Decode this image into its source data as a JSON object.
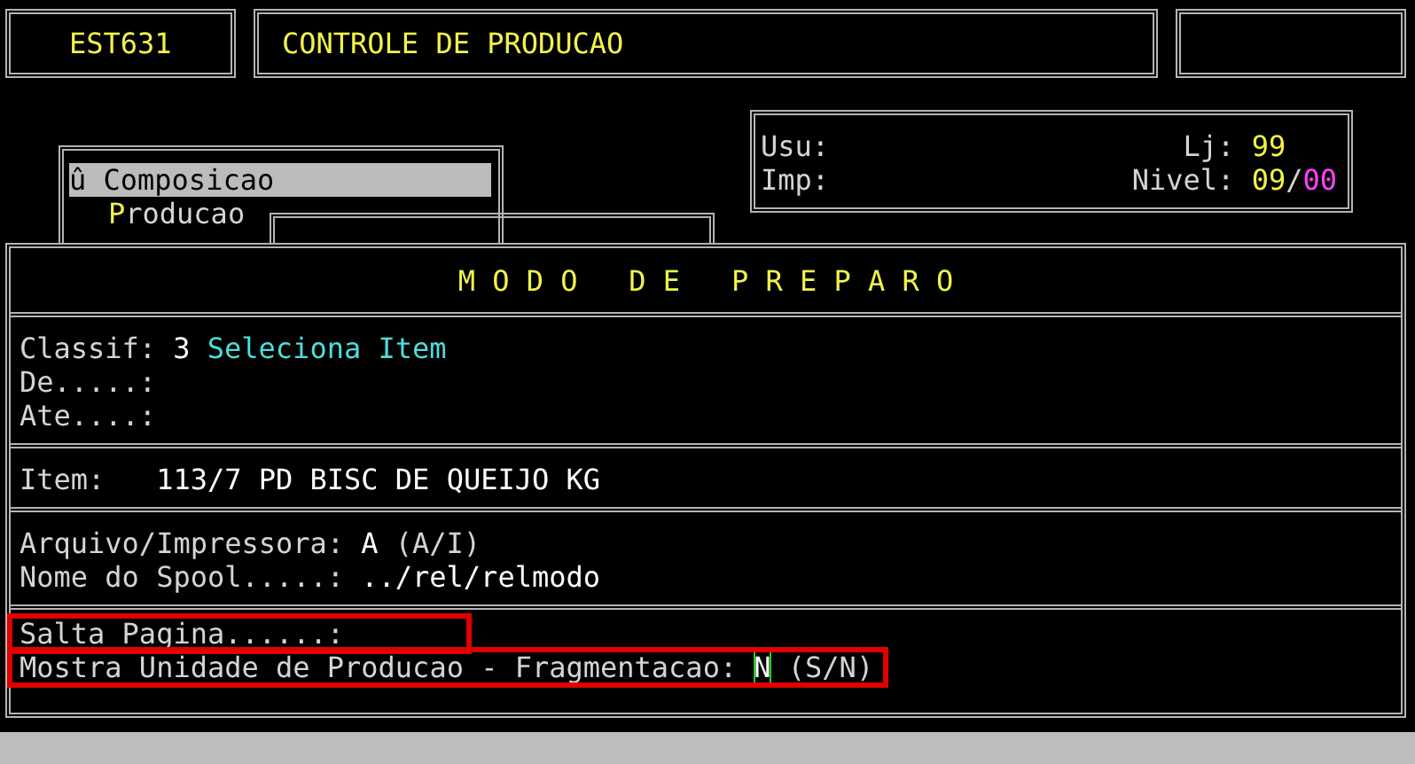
{
  "header": {
    "program_code": "EST631",
    "title": "CONTROLE DE PRODUCAO"
  },
  "menu": {
    "items": [
      {
        "label": "û Composicao",
        "selected": true
      },
      {
        "label": "Producao",
        "selected": false
      }
    ]
  },
  "info": {
    "usu_label": "Usu:",
    "imp_label": "Imp:",
    "lj_label": "Lj:",
    "lj_value": "99",
    "nivel_label": "Nivel:",
    "nivel_value": "09",
    "nivel_separator": "/",
    "nivel_sublevel": "00"
  },
  "form": {
    "title": "M O D O   D E   P R E P A R O",
    "sections": [
      {
        "rows": [
          {
            "kind": "selector",
            "label": "Classif:",
            "value": "3",
            "note": "Seleciona Item",
            "annotated": false,
            "cursor": false
          },
          {
            "kind": "field",
            "label": "De.....:",
            "annotated": false
          },
          {
            "kind": "field",
            "label": "Ate....:",
            "annotated": false
          }
        ]
      },
      {
        "rows": [
          {
            "kind": "item",
            "label": "Item:",
            "value": "113/7 PD BISC DE QUEIJO KG",
            "annotated": false,
            "cursor": false
          }
        ]
      },
      {
        "rows": [
          {
            "kind": "field",
            "label": "Arquivo/Impressora:",
            "value": "A",
            "note": "(A/I)",
            "annotated": false,
            "cursor": false
          },
          {
            "kind": "field",
            "label": "Nome do Spool.....:",
            "value": "../rel/relmodo",
            "annotated": false,
            "cursor": false
          }
        ]
      },
      {
        "rows": [
          {
            "kind": "field",
            "label": "Salta Pagina......:",
            "annotated": true
          },
          {
            "kind": "field",
            "label": "Mostra Unidade de Producao - Fragmentacao:",
            "value": "N",
            "note": "(S/N)",
            "annotated": true,
            "cursor": true
          }
        ]
      }
    ]
  }
}
